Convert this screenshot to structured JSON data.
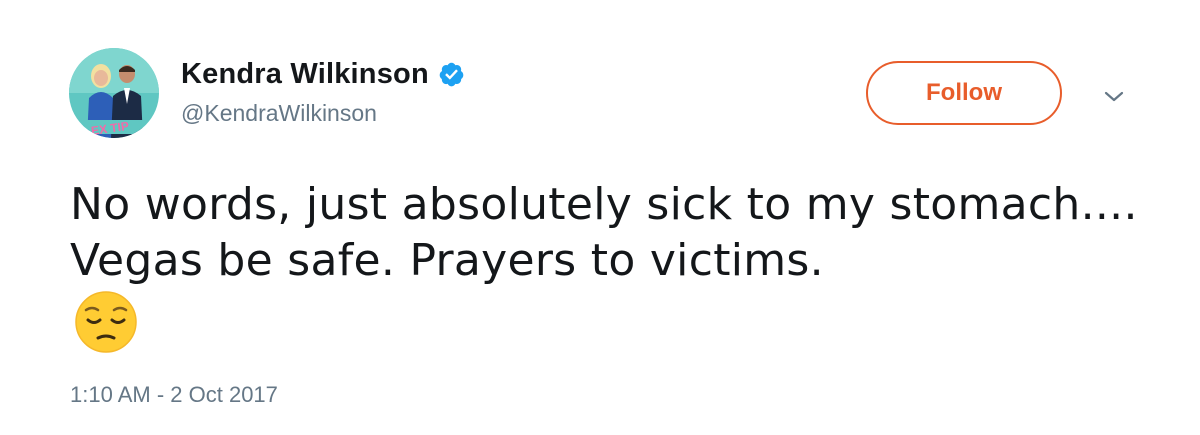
{
  "author": {
    "display_name": "Kendra Wilkinson",
    "handle": "@KendraWilkinson",
    "verified": true,
    "verified_icon": "verified-badge-icon",
    "avatar_icon": "profile-photo"
  },
  "actions": {
    "follow_label": "Follow",
    "more_icon": "chevron-down-icon"
  },
  "tweet": {
    "text": "No words, just absolutely sick to my stomach.... Vegas be safe. Prayers to victims.",
    "emoji_icon": "pensive-face-emoji",
    "timestamp": "1:10 AM - 2 Oct 2017"
  },
  "colors": {
    "follow_accent": "#e85d2b",
    "verified_blue": "#1da1f2",
    "secondary_text": "#657786",
    "primary_text": "#14171a"
  }
}
